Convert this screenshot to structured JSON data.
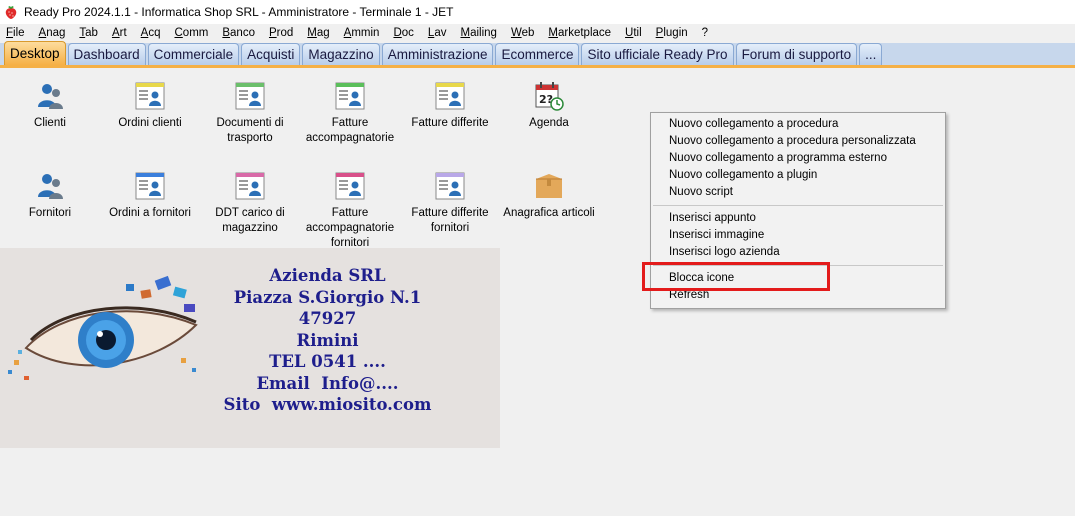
{
  "window": {
    "title": "Ready Pro 2024.1.1 - Informatica Shop SRL - Amministratore - Terminale 1 - JET",
    "icon": "strawberry-icon"
  },
  "menubar": [
    "File",
    "Anag",
    "Tab",
    "Art",
    "Acq",
    "Comm",
    "Banco",
    "Prod",
    "Mag",
    "Ammin",
    "Doc",
    "Lav",
    "Mailing",
    "Web",
    "Marketplace",
    "Util",
    "Plugin",
    "?"
  ],
  "tabs": [
    "Desktop",
    "Dashboard",
    "Commerciale",
    "Acquisti",
    "Magazzino",
    "Amministrazione",
    "Ecommerce",
    "Sito ufficiale Ready Pro",
    "Forum di supporto",
    "..."
  ],
  "active_tab": "Desktop",
  "desktop_icons": {
    "clienti": "Clienti",
    "ordini_clienti": "Ordini clienti",
    "documenti_trasporto": "Documenti di trasporto",
    "fatture_accompagnatorie": "Fatture accompagnatorie",
    "fatture_differite": "Fatture differite",
    "agenda": "Agenda",
    "fornitori": "Fornitori",
    "ordini_fornitori": "Ordini a fornitori",
    "ddt_carico": "DDT carico di magazzino",
    "fatture_acc_fornitori": "Fatture accompagnatorie fornitori",
    "fatture_diff_fornitori": "Fatture differite fornitori",
    "anagrafica_articoli": "Anagrafica articoli"
  },
  "company": {
    "name": "Azienda SRL",
    "address": "Piazza S.Giorgio N.1",
    "cap": "47927",
    "city": "Rimini",
    "tel": "TEL 0541 ....",
    "email": "Email  Info@....",
    "site": "Sito  www.miosito.com"
  },
  "context_menu": {
    "group1": [
      "Nuovo collegamento a procedura",
      "Nuovo collegamento a procedura personalizzata",
      "Nuovo collegamento a programma esterno",
      "Nuovo collegamento a plugin",
      "Nuovo script"
    ],
    "group2": [
      "Inserisci appunto",
      "Inserisci immagine",
      "Inserisci logo azienda"
    ],
    "group3": [
      "Blocca icone",
      "Refresh"
    ]
  },
  "colors": {
    "accent_tab": "#f5b046",
    "tab_blue": "#c7d7ec",
    "company_text": "#1e1e8c",
    "highlight": "#e31b1b"
  }
}
